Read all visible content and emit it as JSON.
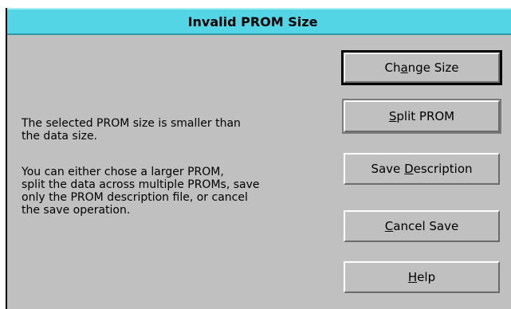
{
  "dialog": {
    "title": "Invalid PROM Size",
    "message_line1": "The selected PROM size is smaller than",
    "message_line2": "the data size.",
    "message_line3": "You can either chose a larger PROM,",
    "message_line4": "split the data across multiple PROMs, save",
    "message_line5": "only the PROM description file, or cancel",
    "message_line6": "the save operation."
  },
  "buttons": {
    "change_size": {
      "pre": "Ch",
      "mnemonic": "a",
      "post": "nge Size"
    },
    "split_prom": {
      "pre": "",
      "mnemonic": "S",
      "post": "plit PROM"
    },
    "save_description": {
      "pre": "Save ",
      "mnemonic": "D",
      "post": "escription"
    },
    "cancel_save": {
      "pre": "",
      "mnemonic": "C",
      "post": "ancel Save"
    },
    "help": {
      "pre": "",
      "mnemonic": "H",
      "post": "elp"
    }
  },
  "colors": {
    "titlebar": "#54d5e6",
    "dialog_background": "#c0c0c0"
  }
}
